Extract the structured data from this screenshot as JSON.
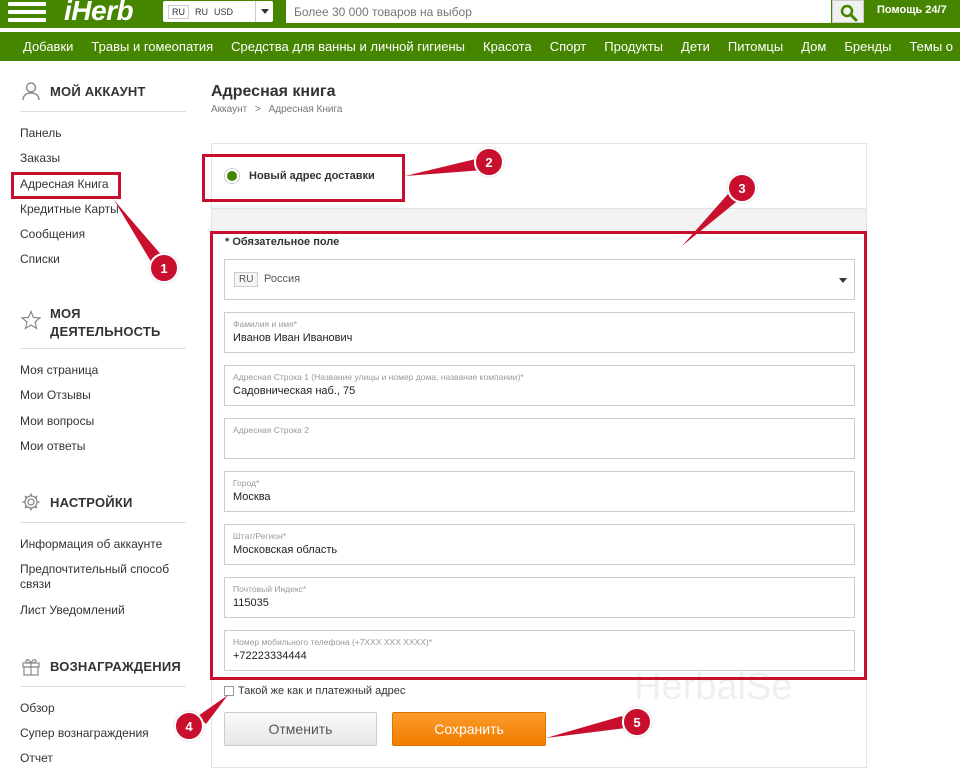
{
  "header": {
    "logo": "iHerb",
    "locale": {
      "language": "RU",
      "country": "RU",
      "currency": "USD"
    },
    "search": {
      "placeholder": "Более 30 000 товаров на выбор"
    },
    "help_label": "Помощь 24/7",
    "brand_color": "#458500"
  },
  "categories": [
    "Добавки",
    "Травы и гомеопатия",
    "Средства для ванны и личной гигиены",
    "Красота",
    "Спорт",
    "Продукты",
    "Дети",
    "Питомцы",
    "Дом",
    "Бренды",
    "Темы о"
  ],
  "sidebar": {
    "account": {
      "title": "МОЙ АККАУНТ",
      "icon": "user-icon",
      "items": [
        "Панель",
        "Заказы",
        "Адресная Книга",
        "Кредитные Карты",
        "Сообщения",
        "Списки"
      ]
    },
    "activity": {
      "title_line1": "МОЯ",
      "title_line2": "ДЕЯТЕЛЬНОСТЬ",
      "icon": "star-icon",
      "items": [
        "Моя страница",
        "Мои Отзывы",
        "Мои вопросы",
        "Мои ответы"
      ]
    },
    "settings": {
      "title": "НАСТРОЙКИ",
      "icon": "gear-icon",
      "items": [
        "Информация об аккаунте",
        "Предпочтительный способ",
        "связи",
        "Лист Уведомлений"
      ]
    },
    "rewards": {
      "title": "ВОЗНАГРАЖДЕНИЯ",
      "icon": "gift-icon",
      "items": [
        "Обзор",
        "Супер вознаграждения",
        "Отчет"
      ]
    }
  },
  "main": {
    "title": "Адресная книга",
    "breadcrumb": {
      "root": "Аккаунт",
      "separator": ">",
      "current": "Адресная Книга"
    },
    "new_address_label": "Новый адрес доставки",
    "required_note": "* Обязательное поле",
    "country": {
      "code": "RU",
      "name": "Россия"
    },
    "fields": {
      "name": {
        "label": "Фамилия и имя*",
        "value": "Иванов Иван Иванович"
      },
      "address1": {
        "label": "Адресная Строка 1 (Название улицы и номер дома; название компании)*",
        "value": "Садовническая наб., 75"
      },
      "address2": {
        "label": "Адресная Строка 2",
        "value": ""
      },
      "city": {
        "label": "Город*",
        "value": "Москва"
      },
      "region": {
        "label": "Штат/Регион*",
        "value": "Московская область"
      },
      "zip": {
        "label": "Почтовый Индекс*",
        "value": "115035"
      },
      "phone": {
        "label": "Номер мобильного телефона (+7XXX XXX XXXX)*",
        "value": "+72223334444"
      }
    },
    "same_as_billing_label": "Такой же как и платежный адрес",
    "cancel_label": "Отменить",
    "save_label": "Сохранить",
    "watermark": "HerbalSe"
  },
  "annotations": {
    "color": "#c8102e",
    "badges": [
      "1",
      "2",
      "3",
      "4",
      "5"
    ]
  }
}
